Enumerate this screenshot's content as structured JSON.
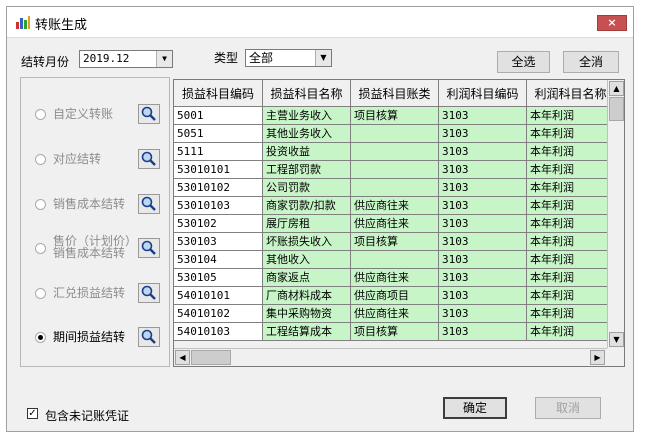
{
  "window": {
    "title": "转账生成",
    "close_glyph": "×"
  },
  "filters": {
    "month_label": "结转月份",
    "month_value": "2019.12",
    "type_label": "类型",
    "type_value": "全部"
  },
  "buttons": {
    "select_all": "全选",
    "deselect_all": "全消",
    "ok": "确定",
    "cancel": "取消"
  },
  "options": [
    {
      "label": "自定义转账",
      "selected": false
    },
    {
      "label": "对应结转",
      "selected": false
    },
    {
      "label": "销售成本结转",
      "selected": false
    },
    {
      "label_line1": "售价（计划价）",
      "label_line2": "销售成本结转",
      "selected": false
    },
    {
      "label": "汇兑损益结转",
      "selected": false
    },
    {
      "label": "期间损益结转",
      "selected": true
    }
  ],
  "table": {
    "columns": [
      "损益科目编码",
      "损益科目名称",
      "损益科目账类",
      "利润科目编码",
      "利润科目名称"
    ],
    "rows": [
      [
        "5001",
        "主营业务收入",
        "项目核算",
        "3103",
        "本年利润"
      ],
      [
        "5051",
        "其他业务收入",
        "",
        "3103",
        "本年利润"
      ],
      [
        "5111",
        "投资收益",
        "",
        "3103",
        "本年利润"
      ],
      [
        "53010101",
        "工程部罚款",
        "",
        "3103",
        "本年利润"
      ],
      [
        "53010102",
        "公司罚款",
        "",
        "3103",
        "本年利润"
      ],
      [
        "53010103",
        "商家罚款/扣款",
        "供应商往来",
        "3103",
        "本年利润"
      ],
      [
        "530102",
        "展厅房租",
        "供应商往来",
        "3103",
        "本年利润"
      ],
      [
        "530103",
        "坏账损失收入",
        "项目核算",
        "3103",
        "本年利润"
      ],
      [
        "530104",
        "其他收入",
        "",
        "3103",
        "本年利润"
      ],
      [
        "530105",
        "商家返点",
        "供应商往来",
        "3103",
        "本年利润"
      ],
      [
        "54010101",
        "厂商材料成本",
        "供应商项目",
        "3103",
        "本年利润"
      ],
      [
        "54010102",
        "集中采购物资",
        "供应商往来",
        "3103",
        "本年利润"
      ],
      [
        "54010103",
        "工程结算成本",
        "项目核算",
        "3103",
        "本年利润"
      ]
    ]
  },
  "include_unposted": {
    "label": "包含未记账凭证",
    "checked": true,
    "glyph": "✓"
  }
}
